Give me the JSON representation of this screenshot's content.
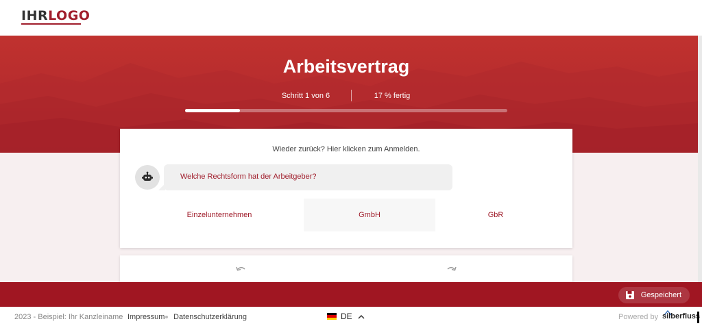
{
  "header": {
    "logo_part1": "IHR",
    "logo_part2": "LOGO"
  },
  "hero": {
    "title": "Arbeitsvertrag",
    "step_text": "Schritt 1 von 6",
    "percent_text": "17 % fertig",
    "progress": 0.17
  },
  "card": {
    "login_prompt": "Wieder zurück? Hier klicken zum Anmelden.",
    "question": "Welche Rechtsform hat der Arbeitgeber?",
    "options": [
      "Einzelunternehmen",
      "GmbH",
      "GbR"
    ]
  },
  "bottombar": {
    "saved_label": "Gespeichert"
  },
  "footer": {
    "copyright": "2023 - Beispiel: Ihr Kanzleiname",
    "impressum": "Impressum",
    "privacy": "Datenschutzerklärung",
    "language": "DE",
    "powered_by": "Powered by",
    "brand": "silberfluss"
  },
  "colors": {
    "accent": "#a01d2b",
    "hero": "#b42a2d",
    "bottombar": "#a01622"
  },
  "icons": [
    "robot-icon",
    "undo-icon",
    "redo-icon",
    "save-icon",
    "german-flag-icon",
    "chevron-up-icon"
  ]
}
